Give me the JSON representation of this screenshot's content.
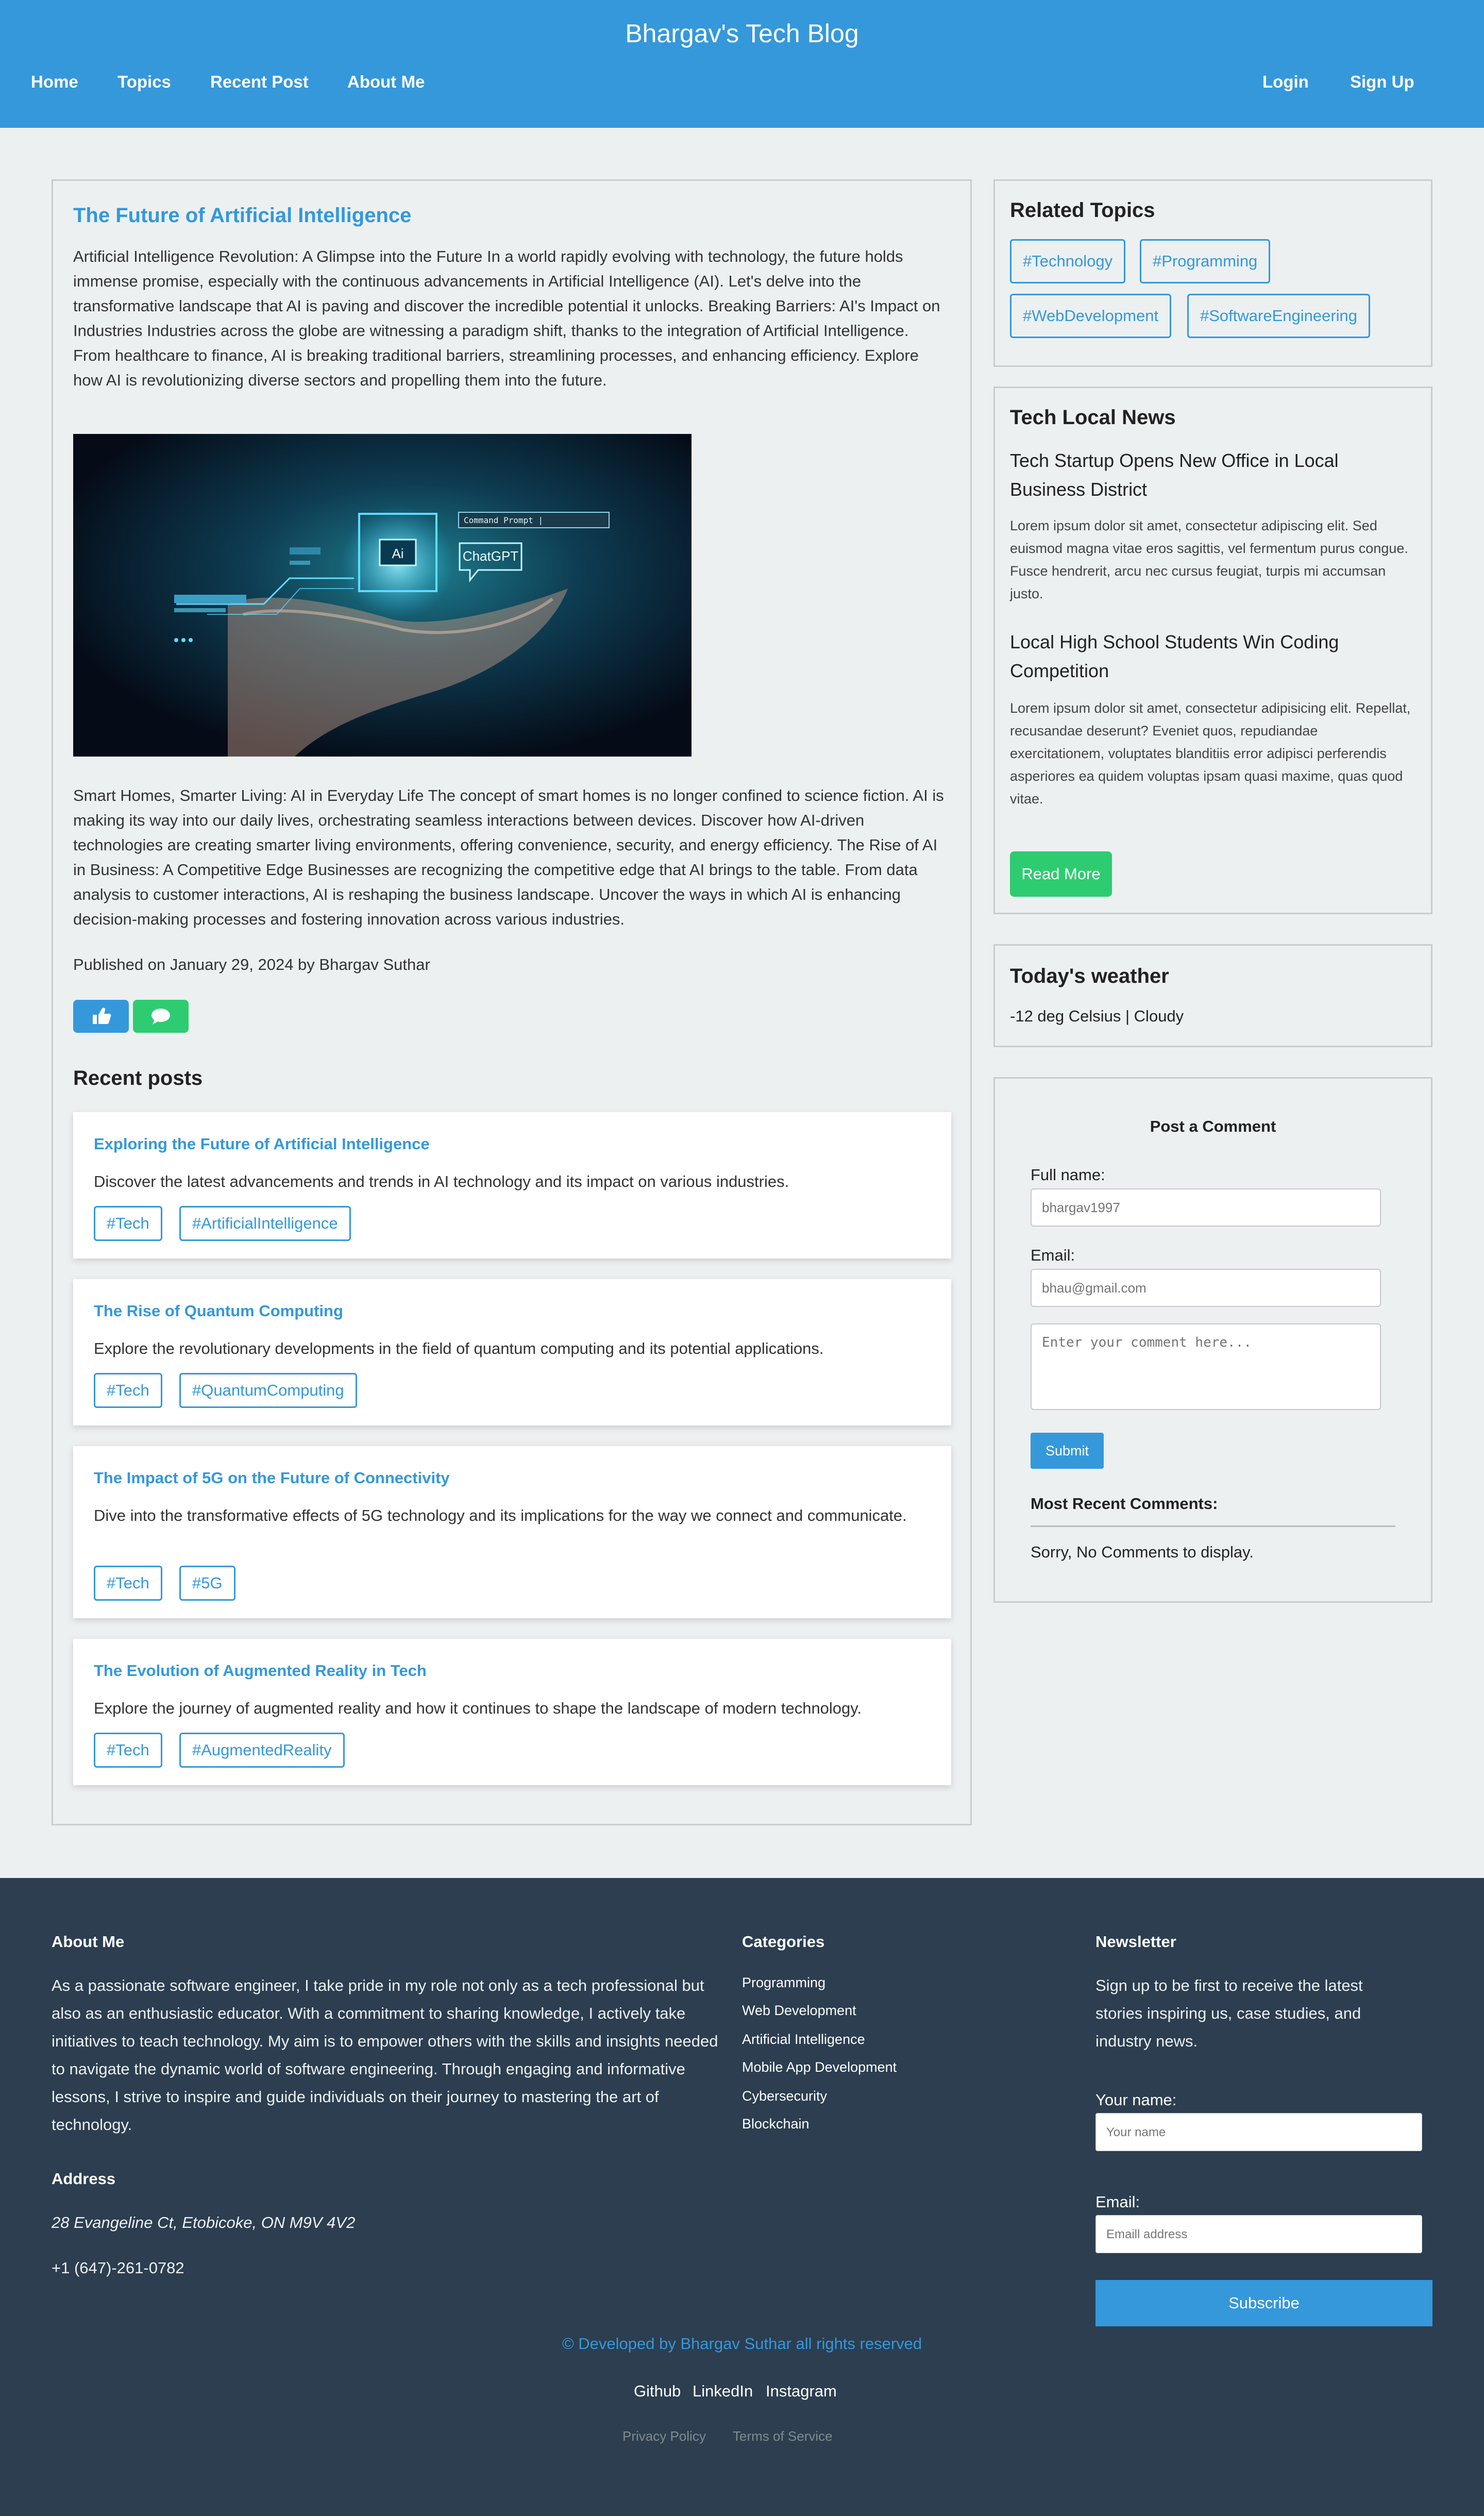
{
  "header": {
    "title": "Bhargav's Tech Blog",
    "nav": [
      "Home",
      "Topics",
      "Recent Post",
      "About Me"
    ],
    "login": "Login",
    "signup": "Sign Up",
    "color": "#3498db"
  },
  "article": {
    "title": "The Future of Artificial Intelligence",
    "intro": "Artificial Intelligence Revolution: A Glimpse into the Future In a world rapidly evolving with technology, the future holds immense promise, especially with the continuous advancements in Artificial Intelligence (AI). Let's delve into the transformative landscape that AI is paving and discover the incredible potential it unlocks. Breaking Barriers: AI's Impact on Industries Industries across the globe are witnessing a paradigm shift, thanks to the integration of Artificial Intelligence. From healthcare to finance, AI is breaking traditional barriers, streamlining processes, and enhancing efficiency. Explore how AI is revolutionizing diverse sectors and propelling them into the future.",
    "image": {
      "badge": "Ai",
      "command_prompt": "Command Prompt |",
      "chat_label": "ChatGPT"
    },
    "body": "Smart Homes, Smarter Living: AI in Everyday Life The concept of smart homes is no longer confined to science fiction. AI is making its way into our daily lives, orchestrating seamless interactions between devices. Discover how AI-driven technologies are creating smarter living environments, offering convenience, security, and energy efficiency. The Rise of AI in Business: A Competitive Edge Businesses are recognizing the competitive edge that AI brings to the table. From data analysis to customer interactions, AI is reshaping the business landscape. Uncover the ways in which AI is enhancing decision-making processes and fostering innovation across various industries.",
    "published": "Published on January 29, 2024 by Bhargav Suthar",
    "icons": [
      "thumbs-up-icon",
      "comment-icon"
    ],
    "like_color": "#3498db",
    "comment_color": "#2ecc71"
  },
  "recent_posts": {
    "heading": "Recent posts",
    "posts": [
      {
        "title": "Exploring the Future of Artificial Intelligence",
        "description": "Discover the latest advancements and trends in AI technology and its impact on various industries.",
        "tags": [
          "#Tech",
          "#ArtificialIntelligence"
        ]
      },
      {
        "title": "The Rise of Quantum Computing",
        "description": "Explore the revolutionary developments in the field of quantum computing and its potential applications.",
        "tags": [
          "#Tech",
          "#QuantumComputing"
        ]
      },
      {
        "title": "The Impact of 5G on the Future of Connectivity",
        "description": "Dive into the transformative effects of 5G technology and its implications for the way we connect and communicate.",
        "tags": [
          "#Tech",
          "#5G"
        ]
      },
      {
        "title": "The Evolution of Augmented Reality in Tech",
        "description": "Explore the journey of augmented reality and how it continues to shape the landscape of modern technology.",
        "tags": [
          "#Tech",
          "#AugmentedReality"
        ]
      }
    ]
  },
  "sidebar": {
    "related": {
      "heading": "Related Topics",
      "tags": [
        "#Technology",
        "#Programming",
        "#WebDevelopment",
        "#SoftwareEngineering"
      ]
    },
    "news": {
      "heading": "Tech Local News",
      "items": [
        {
          "title": "Tech Startup Opens New Office in Local Business District",
          "text": "Lorem ipsum dolor sit amet, consectetur adipiscing elit. Sed euismod magna vitae eros sagittis, vel fermentum purus congue. Fusce hendrerit, arcu nec cursus feugiat, turpis mi accumsan justo."
        },
        {
          "title": "Local High School Students Win Coding Competition",
          "text": "Lorem ipsum dolor sit amet, consectetur adipisicing elit. Repellat, recusandae deserunt? Eveniet quos, repudiandae exercitationem, voluptates blanditiis error adipisci perferendis asperiores ea quidem voluptas ipsam quasi maxime, quas quod vitae."
        }
      ],
      "read_more": "Read More"
    },
    "weather": {
      "heading": "Today's weather",
      "text": "-12 deg Celsius | Cloudy"
    },
    "comment_form": {
      "heading": "Post a Comment",
      "name_label": "Full name:",
      "name_placeholder": "bhargav1997",
      "email_label": "Email:",
      "email_placeholder": "bhau@gmail.com",
      "comment_placeholder": "Enter your comment here...",
      "submit": "Submit",
      "recent_heading": "Most Recent Comments:",
      "no_comments": "Sorry, No Comments to display."
    }
  },
  "footer": {
    "about": {
      "heading": "About Me",
      "text": "As a passionate software engineer, I take pride in my role not only as a tech professional but also as an enthusiastic educator. With a commitment to sharing knowledge, I actively take initiatives to teach technology. My aim is to empower others with the skills and insights needed to navigate the dynamic world of software engineering. Through engaging and informative lessons, I strive to inspire and guide individuals on their journey to mastering the art of technology."
    },
    "address": {
      "heading": "Address",
      "line": "28 Evangeline Ct, Etobicoke, ON M9V 4V2",
      "phone": "+1 (647)-261-0782"
    },
    "categories": {
      "heading": "Categories",
      "items": [
        "Programming",
        "Web Development",
        "Artificial Intelligence",
        "Mobile App Development",
        "Cybersecurity",
        "Blockchain"
      ]
    },
    "newsletter": {
      "heading": "Newsletter",
      "text": "Sign up to be first to receive the latest stories inspiring us, case studies, and industry news.",
      "name_label": "Your name:",
      "name_placeholder": "Your name",
      "email_label": "Email:",
      "email_placeholder": "Emaill address",
      "subscribe": "Subscribe"
    },
    "credits": "© Developed by Bhargav Suthar all rights reserved",
    "social": [
      "Github",
      "LinkedIn",
      "Instagram"
    ],
    "legal": [
      "Privacy Policy",
      "Terms of Service"
    ],
    "background": "#2c3e50"
  }
}
